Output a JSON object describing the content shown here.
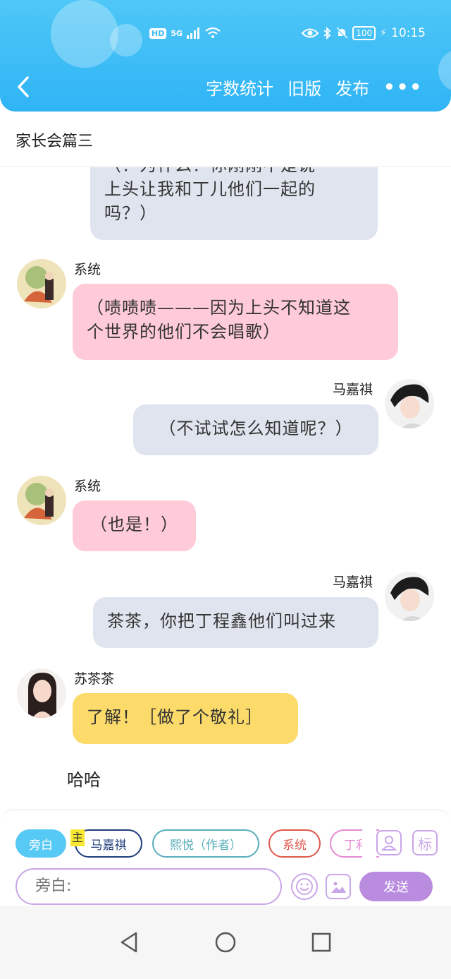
{
  "status_bar": {
    "left": {
      "hd": "HD",
      "signal": "5G"
    },
    "right": {
      "battery": "100",
      "time": "10:15"
    }
  },
  "header": {
    "back_label": "<",
    "actions": {
      "word_count": "字数统计",
      "old_version": "旧版",
      "publish": "发布",
      "more": "•••"
    }
  },
  "title": "家长会篇三",
  "messages": [
    {
      "side": "right",
      "speaker": "",
      "text_line1": "（？为什么？你刚刚不是说",
      "text_line2": "上头让我和丁儿他们一起的",
      "text_line3": "吗？）",
      "color": "gray"
    },
    {
      "side": "left",
      "speaker": "系统",
      "text_line1": "（啧啧啧———因为上头不知道这",
      "text_line2": "个世界的他们不会唱歌）",
      "color": "pink"
    },
    {
      "side": "right",
      "speaker": "马嘉祺",
      "text_line1": "（不试试怎么知道呢？）",
      "color": "gray"
    },
    {
      "side": "left",
      "speaker": "系统",
      "text_line1": "（也是！）",
      "color": "pink"
    },
    {
      "side": "right",
      "speaker": "马嘉祺",
      "text_line1": "茶茶，你把丁程鑫他们叫过来",
      "color": "gray"
    },
    {
      "side": "left",
      "speaker": "苏茶茶",
      "text_line1": "了解！［做了个敬礼］",
      "color": "yellow"
    }
  ],
  "narration": "哈哈",
  "composer": {
    "chips": {
      "narration": "旁白",
      "main_tag": "主",
      "ma": "马嘉祺",
      "xi": "熙悦（作者）",
      "system": "系统",
      "ding": "丁利"
    },
    "tool_person": "👤",
    "tool_mark": "标",
    "input_placeholder": "旁白:",
    "emoji": "☺",
    "image": "▨",
    "send": "发送"
  },
  "colors": {
    "header": "#2fb4f5",
    "bubble_gray": "#dfe4ee",
    "bubble_pink": "#ffcbd8",
    "bubble_yellow": "#fcdb6b",
    "accent_purple": "#b98ce0"
  }
}
